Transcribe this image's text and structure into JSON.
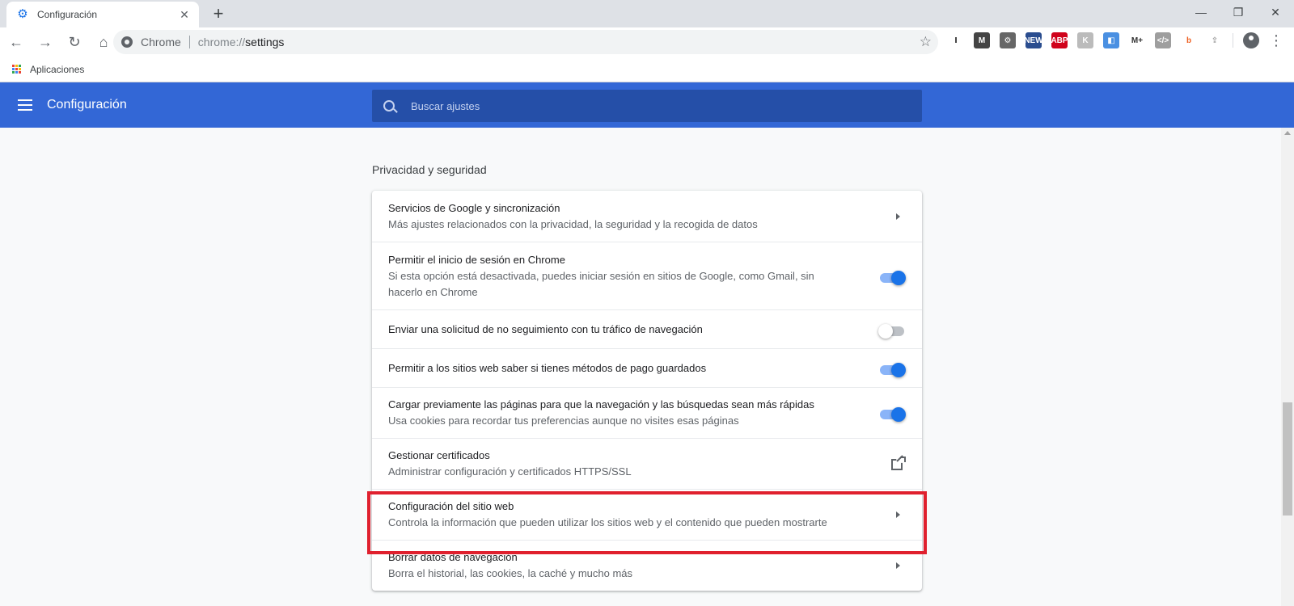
{
  "browser": {
    "tab": {
      "title": "Configuración",
      "icon": "gear-icon"
    },
    "new_tab_label": "+",
    "window_controls": [
      "minimize",
      "restore",
      "close"
    ],
    "omnibox": {
      "site_label": "Chrome",
      "url_prefix": "chrome://",
      "url_path": "settings"
    },
    "extensions": [
      {
        "name": "I",
        "icon": "instapaper-icon",
        "color": "#ffffff",
        "fg": "#000000"
      },
      {
        "name": "M",
        "icon": "m-icon",
        "color": "#444444",
        "fg": "#ffffff"
      },
      {
        "name": "⚙",
        "icon": "gear-ext-icon",
        "color": "#666666",
        "fg": "#ffffff"
      },
      {
        "name": "NEW",
        "icon": "news-icon",
        "color": "#2a4d8f",
        "fg": "#ffffff"
      },
      {
        "name": "ABP",
        "icon": "adblock-plus-icon",
        "color": "#d0021b",
        "fg": "#ffffff"
      },
      {
        "name": "K",
        "icon": "k-icon",
        "color": "#bbbbbb",
        "fg": "#ffffff"
      },
      {
        "name": "◧",
        "icon": "window-ext-icon",
        "color": "#4a90e2",
        "fg": "#ffffff"
      },
      {
        "name": "M+",
        "icon": "mplus-icon",
        "color": "#ffffff",
        "fg": "#333333"
      },
      {
        "name": "</>",
        "icon": "code-icon",
        "color": "#9e9e9e",
        "fg": "#ffffff"
      },
      {
        "name": "b",
        "icon": "bitly-icon",
        "color": "#ffffff",
        "fg": "#ee6123"
      },
      {
        "name": "⇪",
        "icon": "share-ext-icon",
        "color": "#ffffff",
        "fg": "#9e9e9e"
      }
    ]
  },
  "bookmarks": {
    "apps_label": "Aplicaciones"
  },
  "settings": {
    "header_title": "Configuración",
    "search_placeholder": "Buscar ajustes",
    "section_title": "Privacidad y seguridad",
    "rows": [
      {
        "title": "Servicios de Google y sincronización",
        "subtitle": "Más ajustes relacionados con la privacidad, la seguridad y la recogida de datos",
        "control": "arrow"
      },
      {
        "title": "Permitir el inicio de sesión en Chrome",
        "subtitle": "Si esta opción está desactivada, puedes iniciar sesión en sitios de Google, como Gmail, sin hacerlo en Chrome",
        "control": "toggle",
        "enabled": true
      },
      {
        "title": "Enviar una solicitud de no seguimiento con tu tráfico de navegación",
        "subtitle": "",
        "control": "toggle",
        "enabled": false
      },
      {
        "title": "Permitir a los sitios web saber si tienes métodos de pago guardados",
        "subtitle": "",
        "control": "toggle",
        "enabled": true
      },
      {
        "title": "Cargar previamente las páginas para que la navegación y las búsquedas sean más rápidas",
        "subtitle": "Usa cookies para recordar tus preferencias aunque no visites esas páginas",
        "control": "toggle",
        "enabled": true
      },
      {
        "title": "Gestionar certificados",
        "subtitle": "Administrar configuración y certificados HTTPS/SSL",
        "control": "external"
      },
      {
        "title": "Configuración del sitio web",
        "subtitle": "Controla la información que pueden utilizar los sitios web y el contenido que pueden mostrarte",
        "control": "arrow",
        "highlighted": true
      },
      {
        "title": "Borrar datos de navegación",
        "subtitle": "Borra el historial, las cookies, la caché y mucho más",
        "control": "arrow"
      }
    ]
  },
  "colors": {
    "accent": "#3367d6",
    "highlight_box": "#e0202e",
    "toggle_on": "#1a73e8"
  }
}
